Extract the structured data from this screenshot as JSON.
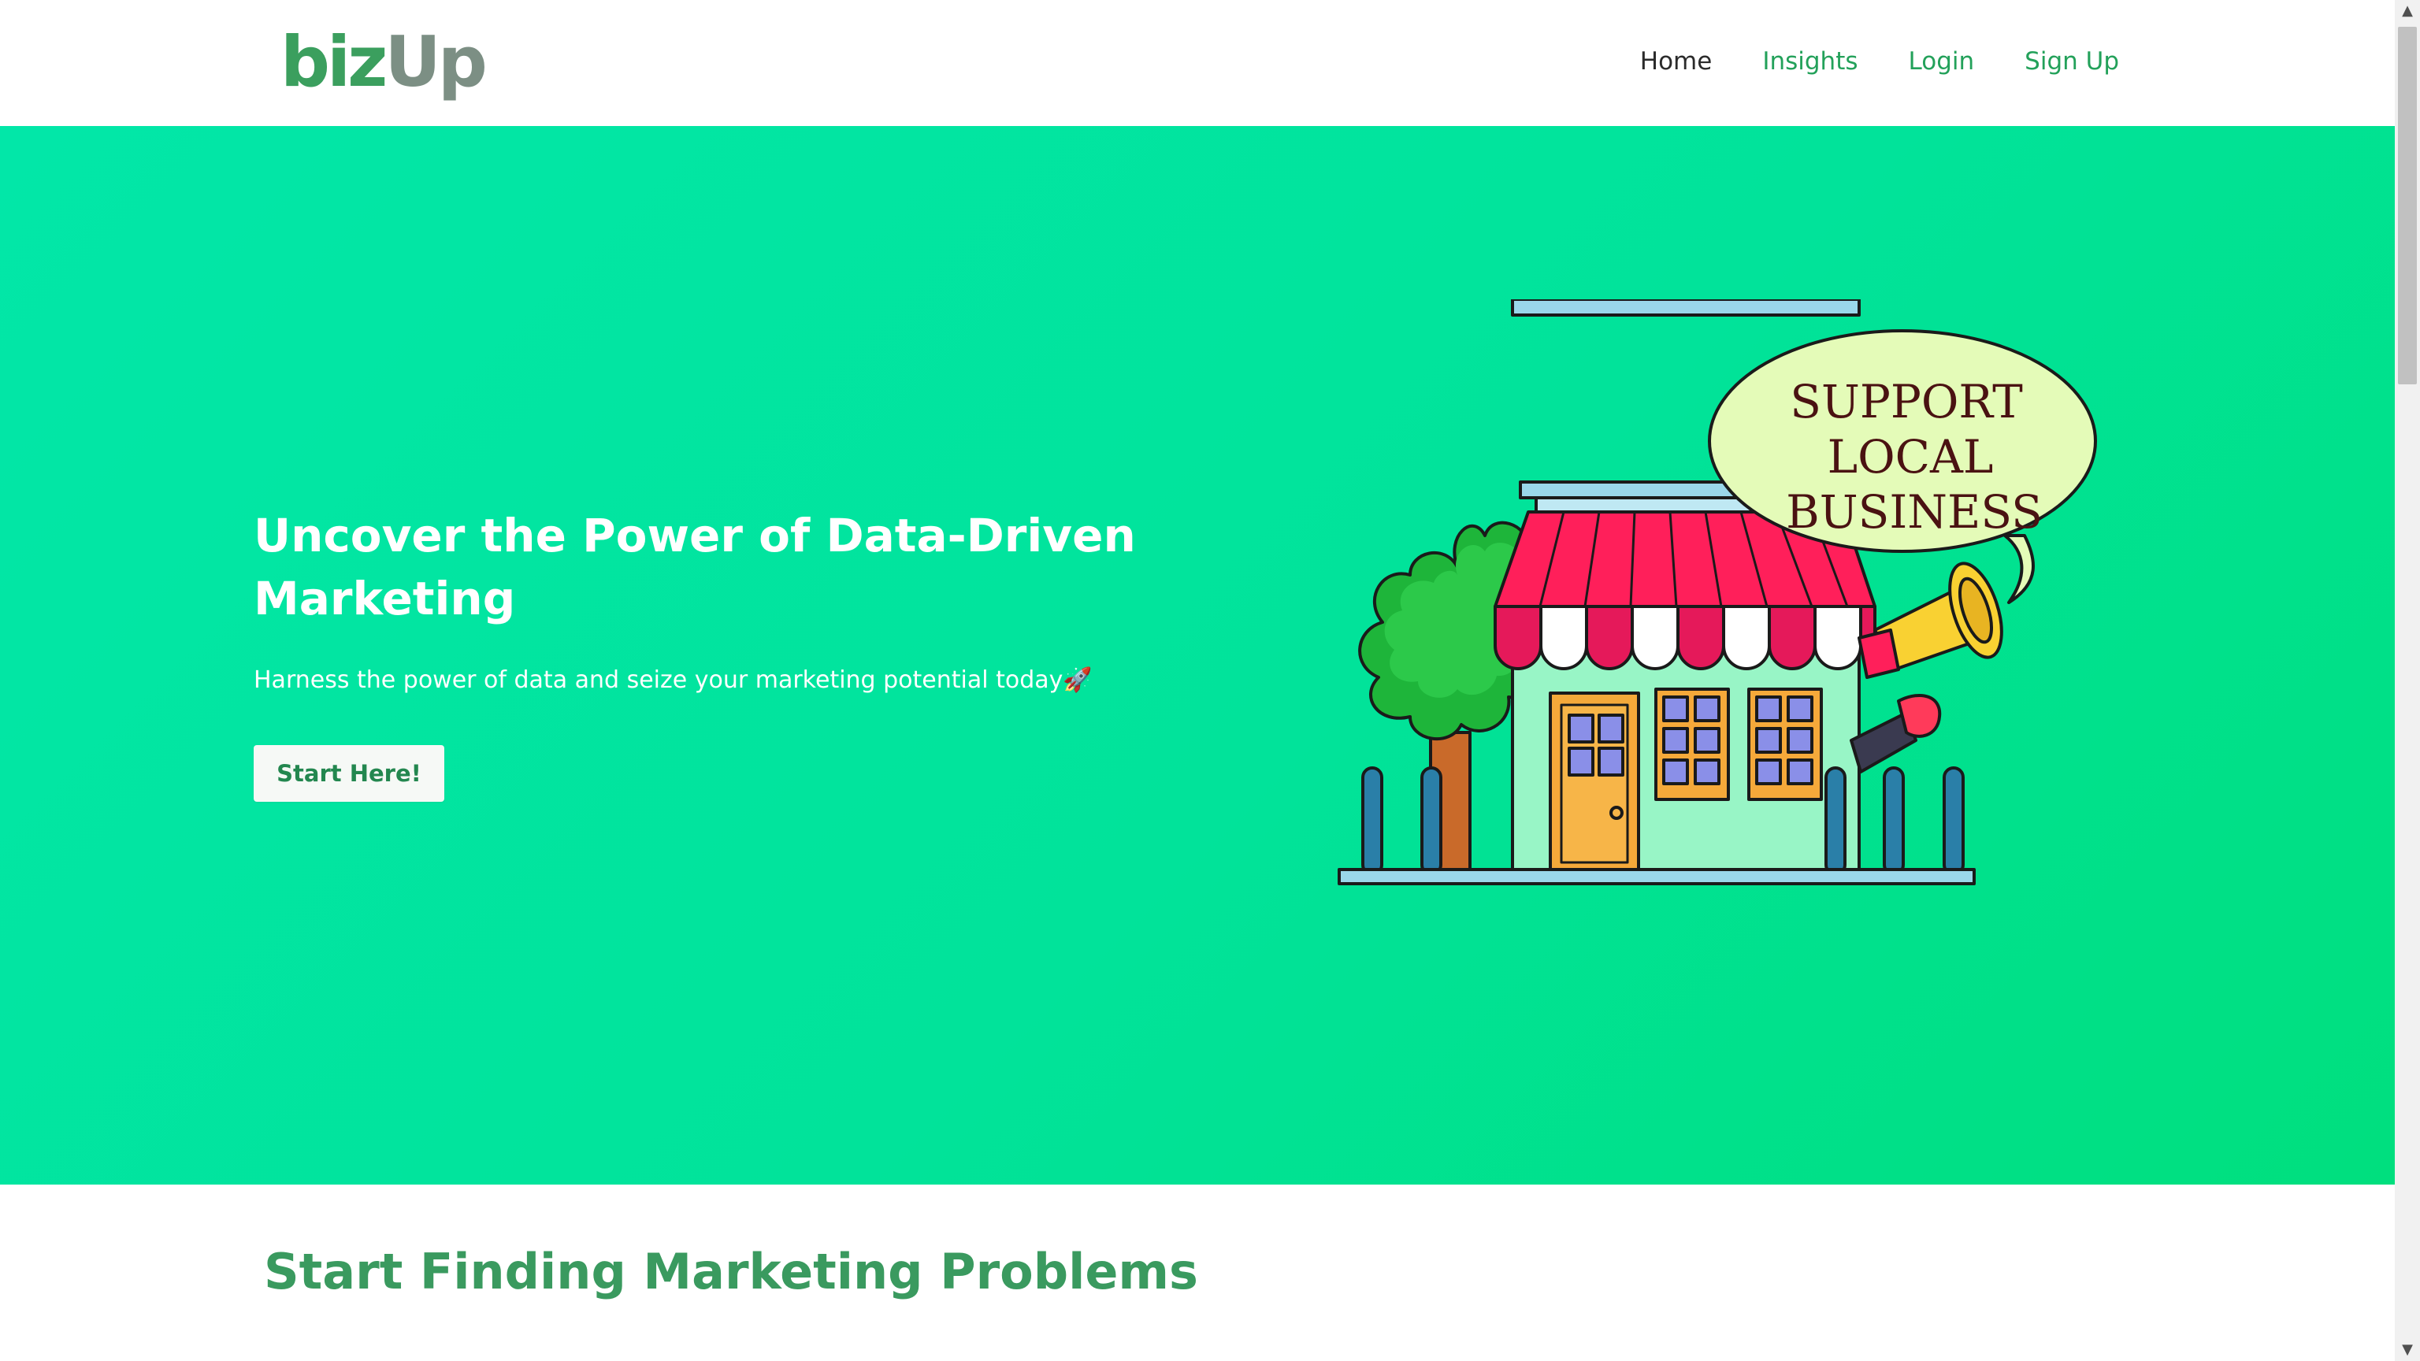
{
  "brand": {
    "logo_biz": "biz",
    "logo_up": "Up",
    "primary_color": "#23a15a",
    "hero_gradient": [
      "#02e7a8",
      "#00df7e"
    ]
  },
  "nav": {
    "items": [
      {
        "label": "Home",
        "active": true
      },
      {
        "label": "Insights",
        "active": false
      },
      {
        "label": "Login",
        "active": false
      },
      {
        "label": "Sign Up",
        "active": false
      }
    ]
  },
  "hero": {
    "title": "Uncover the Power of Data-Driven Marketing",
    "subtitle": "Harness the power of data and seize your marketing potential today🚀",
    "button_label": "Start Here!",
    "illustration": {
      "icon": "storefront-megaphone-illustration",
      "speech_line1": "SUPPORT",
      "speech_line2": "LOCAL",
      "speech_line3": "BUSINESS"
    }
  },
  "section": {
    "heading": "Start Finding Marketing Problems"
  }
}
